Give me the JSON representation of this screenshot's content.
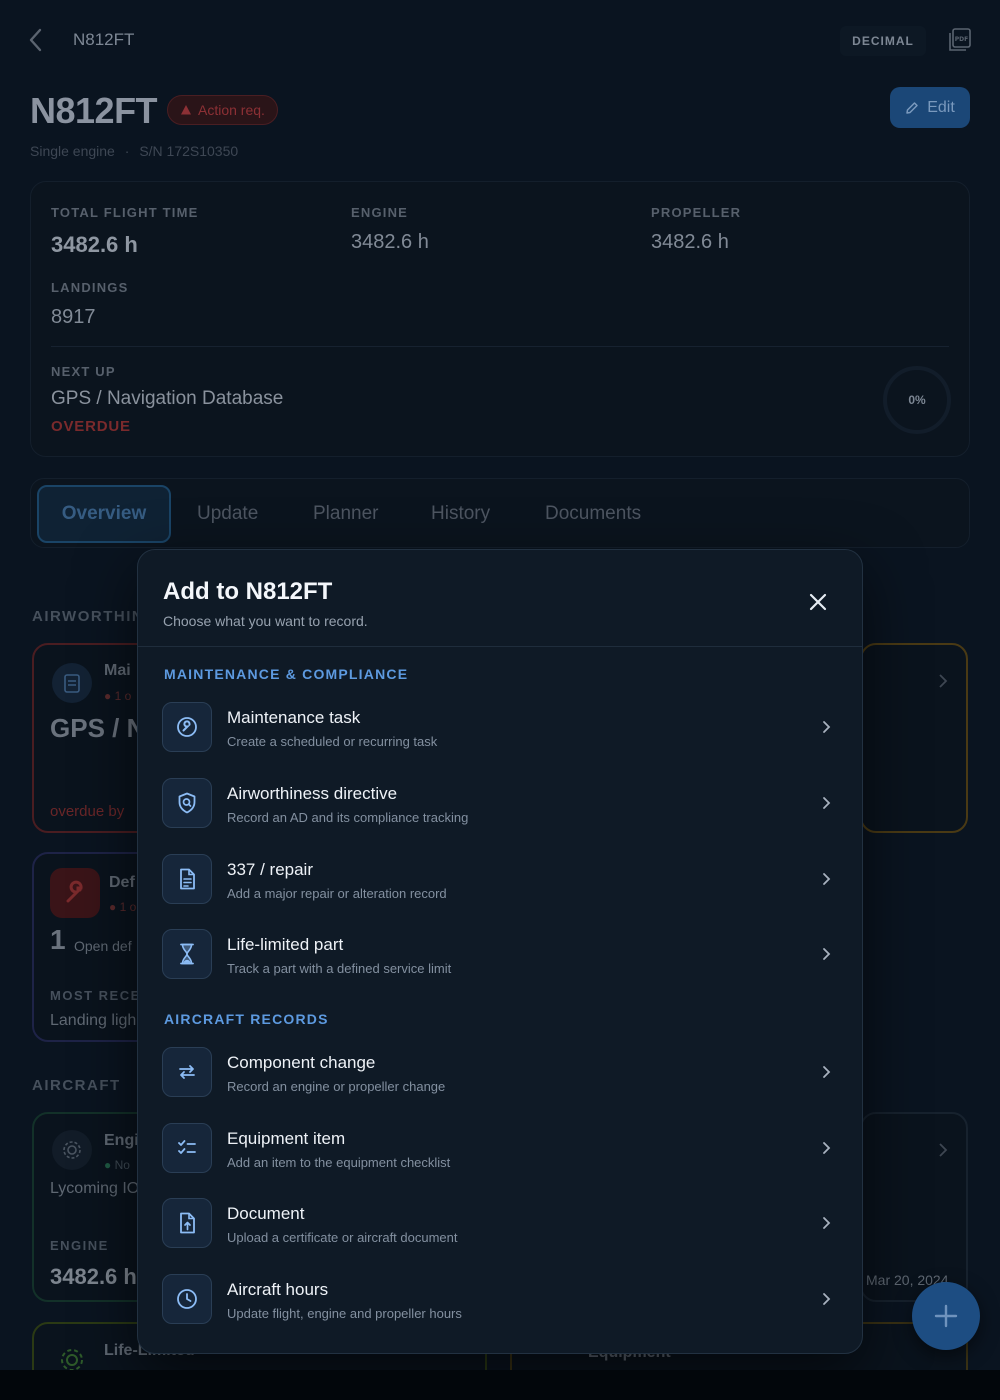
{
  "header": {
    "nav_title": "N812FT",
    "decimal_label": "DECIMAL",
    "tail_number": "N812FT",
    "status_badge": "Action req.",
    "edit_label": "Edit",
    "engine_type": "Single engine",
    "separator": "·",
    "serial": "S/N 172S10350"
  },
  "stats": {
    "total_flight_time_label": "TOTAL FLIGHT TIME",
    "total_flight_time": "3482.6 h",
    "engine_label": "ENGINE",
    "engine": "3482.6 h",
    "propeller_label": "PROPELLER",
    "propeller": "3482.6 h",
    "landings_label": "LANDINGS",
    "landings": "8917",
    "next_up_label": "NEXT UP",
    "next_up_title": "GPS / Navigation Database",
    "next_up_status": "OVERDUE",
    "progress": "0%"
  },
  "tabs": [
    "Overview",
    "Update",
    "Planner",
    "History",
    "Documents"
  ],
  "background": {
    "airworthiness_label": "AIRWORTHIN",
    "maint_title": "Mai",
    "maint_sub": "1 o",
    "maint_big": "GPS / N",
    "maint_overdue": "overdue by",
    "defects_title": "Def",
    "defects_sub": "1 o",
    "defects_count": "1",
    "defects_open": "Open def",
    "most_recent_label": "MOST RECEN",
    "most_recent_value": "Landing ligh",
    "aircraft_label": "AIRCRAFT",
    "engine_card_title": "Engi",
    "engine_card_sub": "No",
    "engine_model": "Lycoming IO",
    "engine_label": "ENGINE",
    "engine_value": "3482.6 h",
    "date_value": "Mar 20, 2024",
    "llp_title": "Life-Limited",
    "equipment_title": "Equipment"
  },
  "modal": {
    "title": "Add to N812FT",
    "subtitle": "Choose what you want to record.",
    "group1_label": "MAINTENANCE & COMPLIANCE",
    "group2_label": "AIRCRAFT RECORDS",
    "group1": [
      {
        "title": "Maintenance task",
        "desc": "Create a scheduled or recurring task",
        "icon": "wrench-icon"
      },
      {
        "title": "Airworthiness directive",
        "desc": "Record an AD and its compliance tracking",
        "icon": "shield-search-icon"
      },
      {
        "title": "337 / repair",
        "desc": "Add a major repair or alteration record",
        "icon": "document-icon"
      },
      {
        "title": "Life-limited part",
        "desc": "Track a part with a defined service limit",
        "icon": "hourglass-icon"
      }
    ],
    "group2": [
      {
        "title": "Component change",
        "desc": "Record an engine or propeller change",
        "icon": "swap-arrows-icon"
      },
      {
        "title": "Equipment item",
        "desc": "Add an item to the equipment checklist",
        "icon": "checklist-icon"
      },
      {
        "title": "Document",
        "desc": "Upload a certificate or aircraft document",
        "icon": "file-upload-icon"
      },
      {
        "title": "Aircraft hours",
        "desc": "Update flight, engine and propeller hours",
        "icon": "clock-icon"
      }
    ]
  },
  "colors": {
    "accent": "#5d9ae0",
    "overdue": "#c0392b",
    "warning": "#e0a43a",
    "background": "#0a1420",
    "modal": "#0f1a26"
  }
}
